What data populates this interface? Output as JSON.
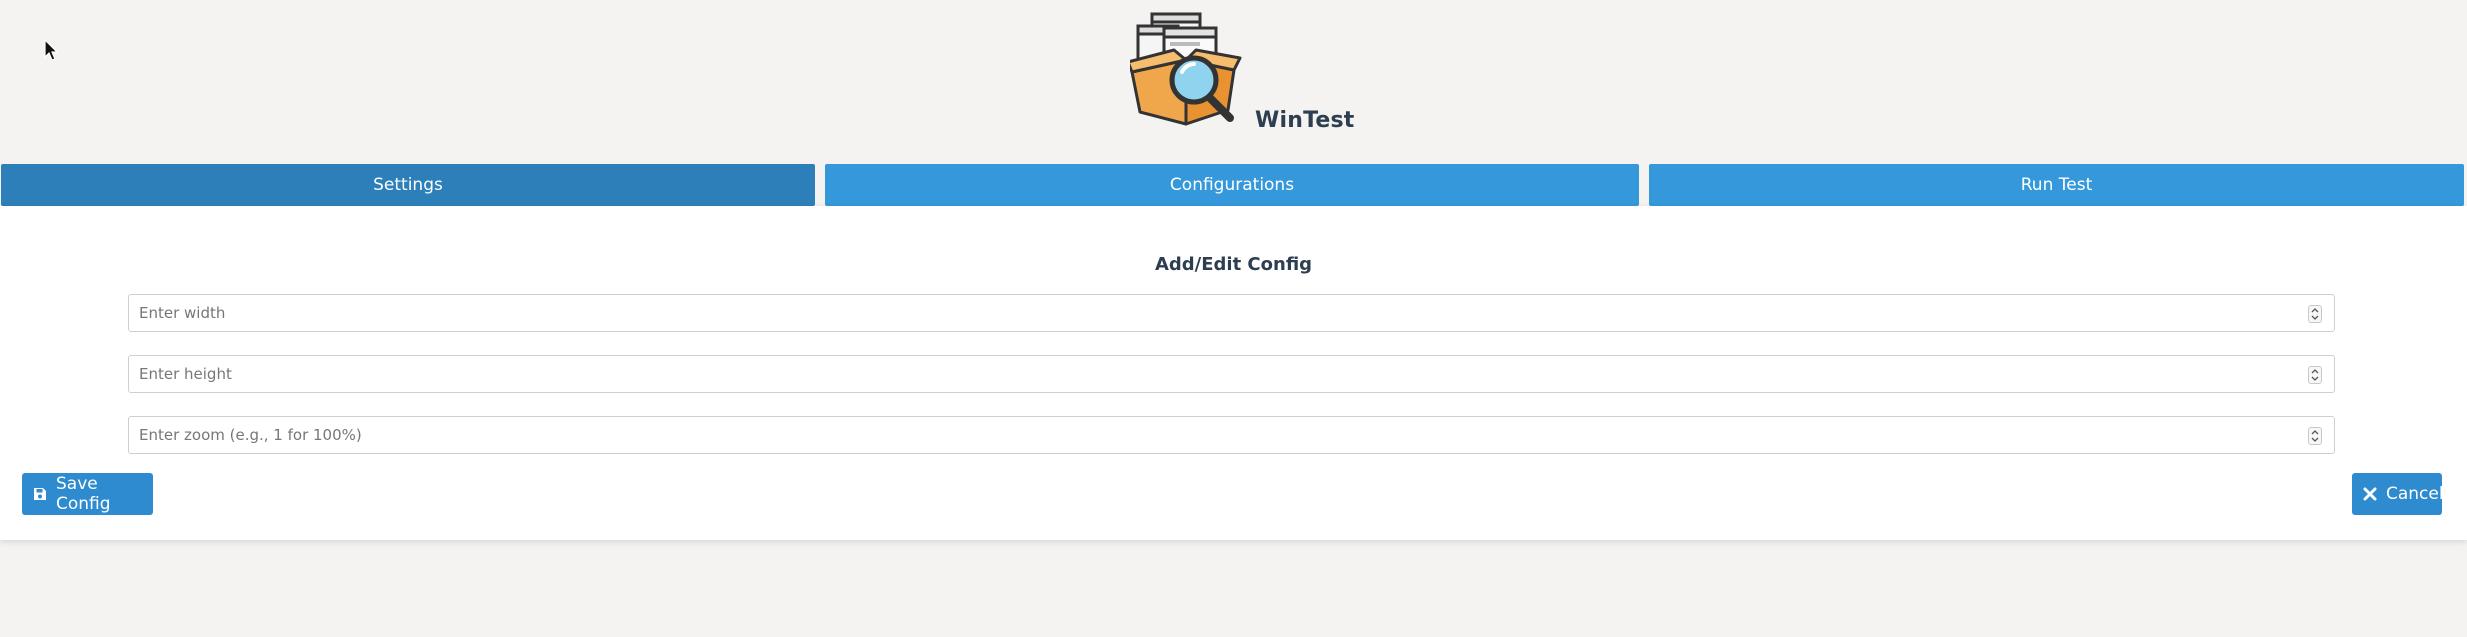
{
  "app": {
    "title": "WinTest",
    "logo": "box-magnifier-logo"
  },
  "tabs": [
    {
      "label": "Settings",
      "active": true
    },
    {
      "label": "Configurations",
      "active": false
    },
    {
      "label": "Run Test",
      "active": false
    }
  ],
  "config_form": {
    "title": "Add/Edit Config",
    "fields": {
      "width": {
        "placeholder": "Enter width",
        "value": ""
      },
      "height": {
        "placeholder": "Enter height",
        "value": ""
      },
      "zoom": {
        "placeholder": "Enter zoom (e.g., 1 for 100%)",
        "value": ""
      }
    },
    "save_label": "Save Config",
    "save_icon": "floppy-disk-icon",
    "cancel_label": "Cancel",
    "cancel_icon": "close-icon"
  },
  "colors": {
    "tab_active": "#2c7fb8",
    "tab": "#3498db",
    "button": "#2e8bd0",
    "title_text": "#2c3e50",
    "page_background": "#f4f3f1"
  }
}
